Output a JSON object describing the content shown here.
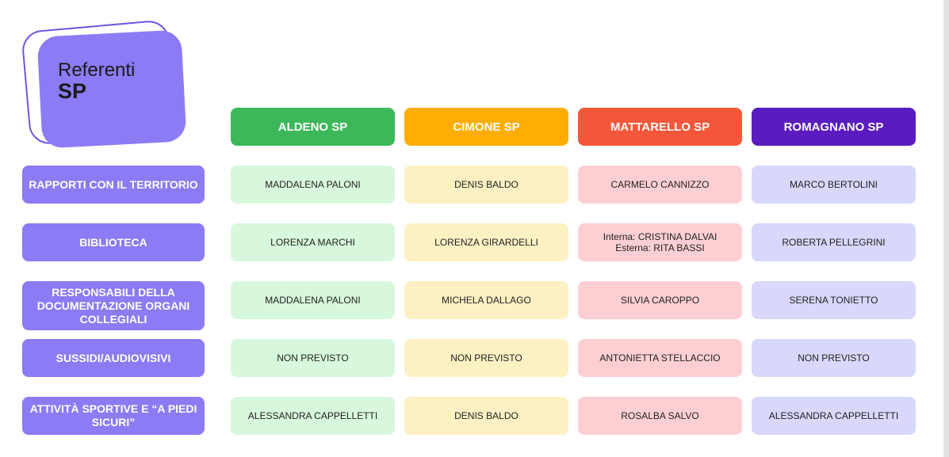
{
  "logo": {
    "line1": "Referenti",
    "line2": "SP"
  },
  "columns": [
    {
      "label": "ALDENO SP",
      "color": "#3cb85a",
      "cell_color": "#d7f8dc"
    },
    {
      "label": "CIMONE SP",
      "color": "#fdad04",
      "cell_color": "#fdf1c3"
    },
    {
      "label": "MATTARELLO SP",
      "color": "#f5573a",
      "cell_color": "#fdcfd3"
    },
    {
      "label": "ROMAGNANO SP",
      "color": "#5a1cc0",
      "cell_color": "#d7d8fb"
    }
  ],
  "rows": [
    {
      "label": "RAPPORTI CON IL TERRITORIO",
      "cells": [
        {
          "lines": [
            "MADDALENA PALONI"
          ]
        },
        {
          "lines": [
            "DENIS BALDO"
          ]
        },
        {
          "lines": [
            "CARMELO CANNIZZO"
          ]
        },
        {
          "lines": [
            "MARCO BERTOLINI"
          ]
        }
      ]
    },
    {
      "label": "BIBLIOTECA",
      "cells": [
        {
          "lines": [
            "LORENZA MARCHI"
          ]
        },
        {
          "lines": [
            "LORENZA GIRARDELLI"
          ]
        },
        {
          "lines": [
            "Interna: CRISTINA DALVAI",
            "Esterna: RITA BASSI"
          ]
        },
        {
          "lines": [
            "ROBERTA PELLEGRINI"
          ]
        }
      ]
    },
    {
      "label": "RESPONSABILI DELLA DOCUMENTAZIONE ORGANI COLLEGIALI",
      "cells": [
        {
          "lines": [
            "MADDALENA PALONI"
          ]
        },
        {
          "lines": [
            "MICHELA DALLAGO"
          ]
        },
        {
          "lines": [
            "SILVIA CAROPPO"
          ]
        },
        {
          "lines": [
            "SERENA TONIETTO"
          ]
        }
      ]
    },
    {
      "label": "SUSSIDI/AUDIOVISIVI",
      "cells": [
        {
          "lines": [
            "NON PREVISTO"
          ]
        },
        {
          "lines": [
            "NON PREVISTO"
          ]
        },
        {
          "lines": [
            "ANTONIETTA STELLACCIO"
          ]
        },
        {
          "lines": [
            "NON PREVISTO"
          ]
        }
      ]
    },
    {
      "label": "ATTIVITÀ SPORTIVE E “A PIEDI SICURI”",
      "cells": [
        {
          "lines": [
            "ALESSANDRA CAPPELLETTI"
          ]
        },
        {
          "lines": [
            "DENIS BALDO"
          ]
        },
        {
          "lines": [
            "ROSALBA SALVO"
          ]
        },
        {
          "lines": [
            "ALESSANDRA CAPPELLETTI"
          ]
        }
      ]
    }
  ]
}
